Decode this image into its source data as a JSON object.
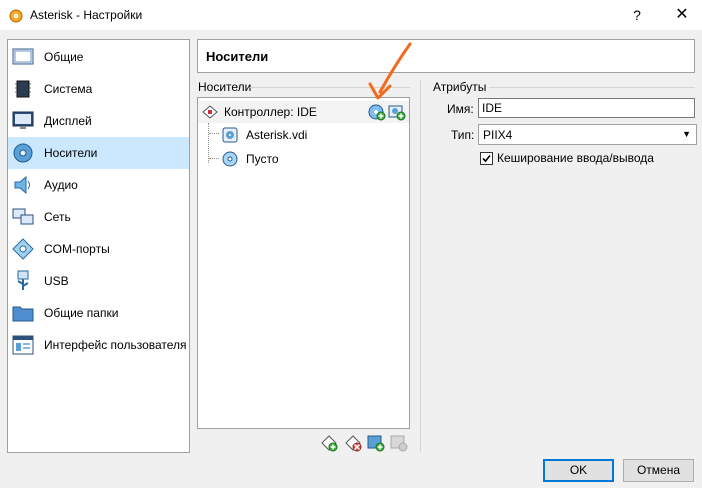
{
  "window": {
    "title": "Asterisk - Настройки",
    "help_glyph": "?",
    "close_glyph": "✕"
  },
  "sidebar": {
    "items": [
      {
        "label": "Общие",
        "icon": "general-icon"
      },
      {
        "label": "Система",
        "icon": "chip-icon"
      },
      {
        "label": "Дисплей",
        "icon": "monitor-icon"
      },
      {
        "label": "Носители",
        "icon": "disk-icon",
        "selected": true
      },
      {
        "label": "Аудио",
        "icon": "speaker-icon"
      },
      {
        "label": "Сеть",
        "icon": "network-icon"
      },
      {
        "label": "COM-порты",
        "icon": "serial-port-icon"
      },
      {
        "label": "USB",
        "icon": "usb-icon"
      },
      {
        "label": "Общие папки",
        "icon": "folder-icon"
      },
      {
        "label": "Интерфейс пользователя",
        "icon": "ui-icon"
      }
    ]
  },
  "header": {
    "title": "Носители"
  },
  "storage": {
    "group_label": "Носители",
    "controller": {
      "label": "Контроллер: IDE",
      "icon": "ide-controller-icon"
    },
    "devices": [
      {
        "label": "Asterisk.vdi",
        "icon": "hard-disk-icon"
      },
      {
        "label": "Пусто",
        "icon": "optical-disc-icon"
      }
    ],
    "toolbar": [
      "add-controller-icon",
      "remove-controller-icon",
      "add-attachment-icon",
      "remove-attachment-icon"
    ]
  },
  "attributes": {
    "group_label": "Атрибуты",
    "name_label": "Имя:",
    "name_value": "IDE",
    "type_label": "Тип:",
    "type_value": "PIIX4",
    "cache_label": "Кеширование ввода/вывода",
    "cache_checked": true
  },
  "buttons": {
    "ok": "OK",
    "cancel": "Отмена"
  },
  "colors": {
    "selection": "#cce8ff",
    "accent": "#0078d7",
    "annotation_arrow": "#f26b1d"
  }
}
